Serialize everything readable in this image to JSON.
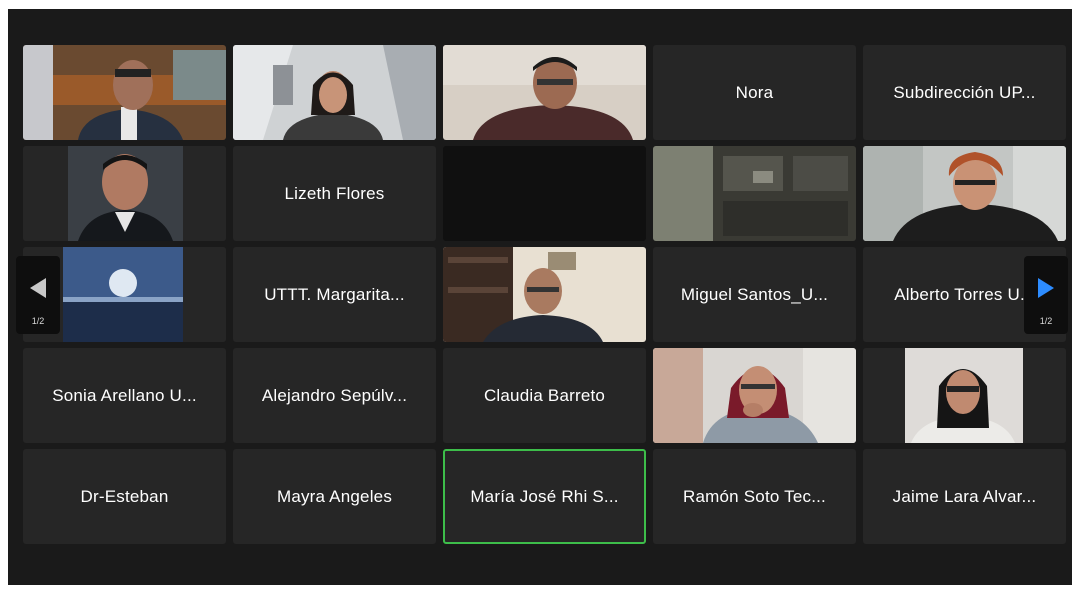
{
  "gallery": {
    "tiles": [
      {
        "name": "",
        "kind": "video"
      },
      {
        "name": "",
        "kind": "video"
      },
      {
        "name": "",
        "kind": "video"
      },
      {
        "name": "Nora",
        "kind": "name"
      },
      {
        "name": "Subdirección UP...",
        "kind": "name"
      },
      {
        "name": "",
        "kind": "video"
      },
      {
        "name": "Lizeth Flores",
        "kind": "name"
      },
      {
        "name": "",
        "kind": "blank"
      },
      {
        "name": "",
        "kind": "video"
      },
      {
        "name": "",
        "kind": "video"
      },
      {
        "name": "",
        "kind": "video"
      },
      {
        "name": "UTTT. Margarita...",
        "kind": "name"
      },
      {
        "name": "",
        "kind": "video"
      },
      {
        "name": "Miguel Santos_U...",
        "kind": "name"
      },
      {
        "name": "Alberto Torres U...",
        "kind": "name"
      },
      {
        "name": "Sonia Arellano U...",
        "kind": "name"
      },
      {
        "name": "Alejandro Sepúlv...",
        "kind": "name"
      },
      {
        "name": "Claudia Barreto",
        "kind": "name"
      },
      {
        "name": "",
        "kind": "video"
      },
      {
        "name": "",
        "kind": "video"
      },
      {
        "name": "Dr-Esteban",
        "kind": "name"
      },
      {
        "name": "Mayra Angeles",
        "kind": "name"
      },
      {
        "name": "María José Rhi S...",
        "kind": "name",
        "active": true
      },
      {
        "name": "Ramón Soto Tec...",
        "kind": "name"
      },
      {
        "name": "Jaime Lara Alvar...",
        "kind": "name"
      }
    ],
    "active_speaker_color": "#3dbd4a"
  },
  "navigation": {
    "prev_icon": "arrow-left-icon",
    "next_icon": "arrow-right-icon",
    "prev_page_label": "1/2",
    "next_page_label": "1/2",
    "prev_arrow_color": "#c8c8c8",
    "next_arrow_color": "#2d8cff"
  }
}
